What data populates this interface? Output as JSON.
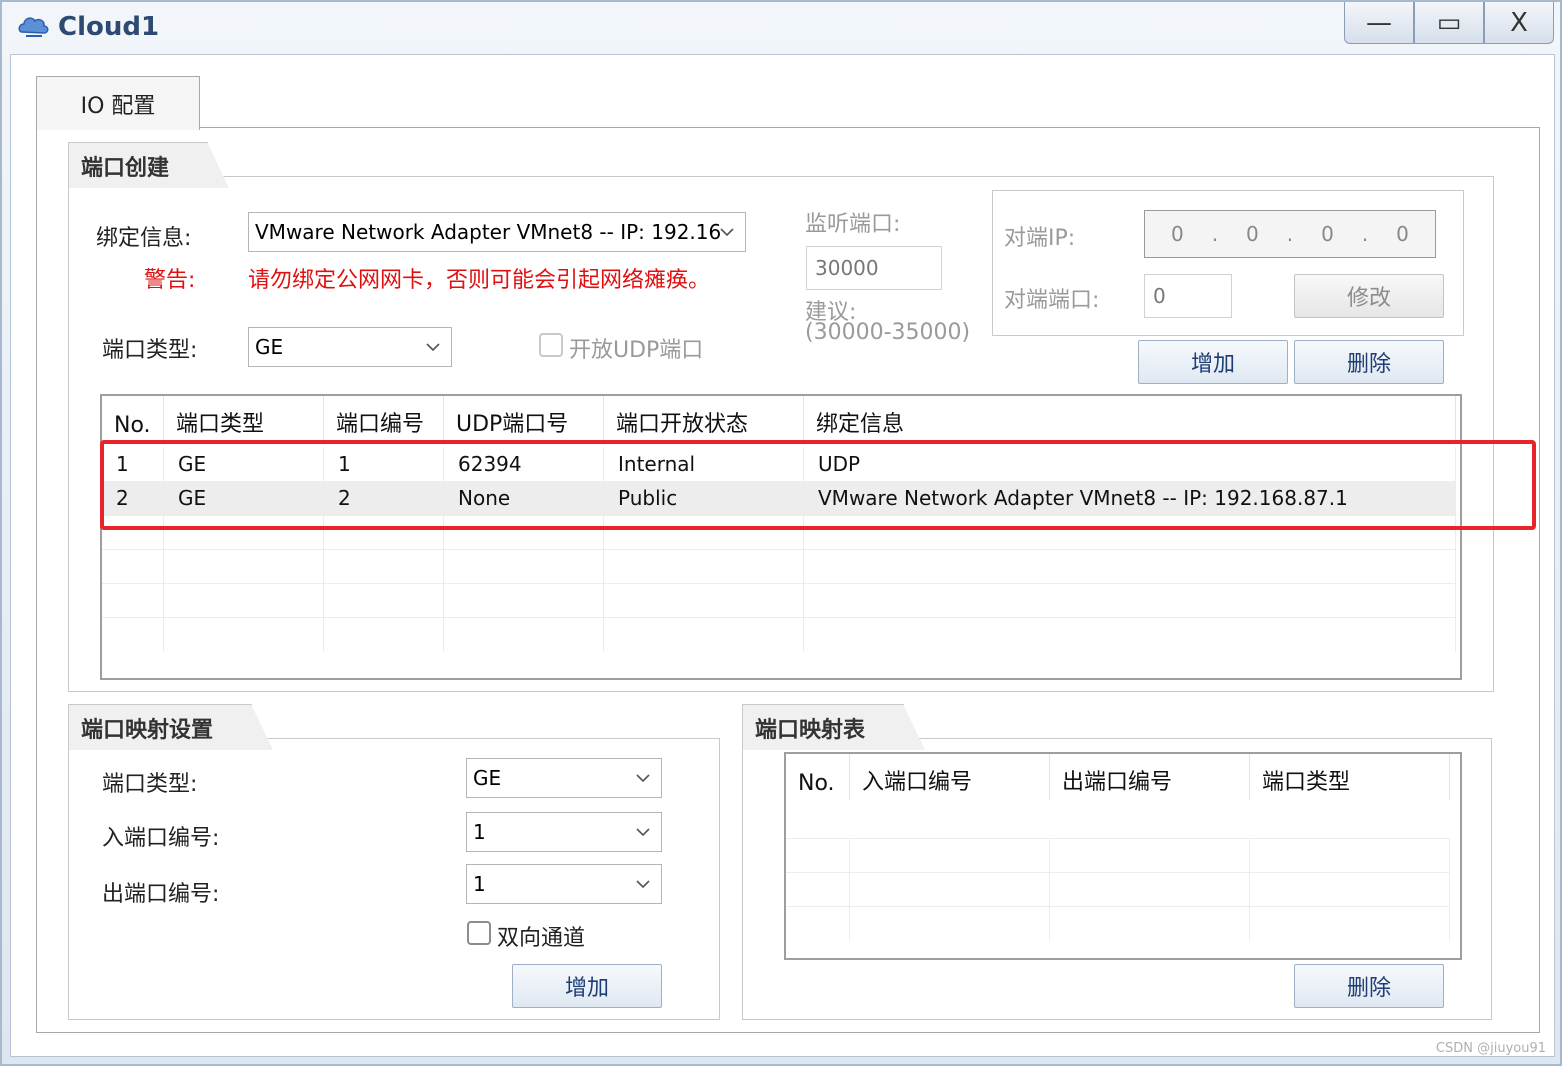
{
  "window": {
    "title": "Cloud1",
    "minimize_glyph": "—",
    "maximize_glyph": "▭",
    "close_glyph": "X"
  },
  "tab": {
    "label": "IO 配置"
  },
  "port_create": {
    "group_title": "端口创建",
    "bind_label": "绑定信息:",
    "bind_value": "VMware Network Adapter VMnet8 -- IP: 192.16",
    "warning_label": "警告:",
    "warning_text": "请勿绑定公网网卡，否则可能会引起网络瘫痪。",
    "port_type_label": "端口类型:",
    "port_type_value": "GE",
    "udp_checkbox_label": "开放UDP端口",
    "listen_port_label": "监听端口:",
    "listen_port_value": "30000",
    "suggest_label": "建议:",
    "suggest_range": "(30000-35000)",
    "peer_ip_label": "对端IP:",
    "peer_ip_octets": [
      "0",
      ".",
      "0",
      ".",
      "0",
      ".",
      "0"
    ],
    "peer_port_label": "对端端口:",
    "peer_port_value": "0",
    "modify_button": "修改",
    "add_button": "增加",
    "delete_button": "删除",
    "table": {
      "columns": [
        "No.",
        "端口类型",
        "端口编号",
        "UDP端口号",
        "端口开放状态",
        "绑定信息"
      ],
      "rows": [
        [
          "1",
          "GE",
          "1",
          "62394",
          "Internal",
          "UDP"
        ],
        [
          "2",
          "GE",
          "2",
          "None",
          "Public",
          "VMware Network Adapter VMnet8 -- IP: 192.168.87.1"
        ]
      ]
    }
  },
  "port_mapping": {
    "group_title": "端口映射设置",
    "port_type_label": "端口类型:",
    "port_type_value": "GE",
    "in_port_label": "入端口编号:",
    "in_port_value": "1",
    "out_port_label": "出端口编号:",
    "out_port_value": "1",
    "bidirectional_label": "双向通道",
    "add_button": "增加"
  },
  "mapping_table": {
    "group_title": "端口映射表",
    "columns": [
      "No.",
      "入端口编号",
      "出端口编号",
      "端口类型"
    ],
    "delete_button": "删除"
  },
  "watermark": "CSDN @jiuyou91",
  "colors": {
    "accent": "#1e3c74",
    "warning": "#e01010",
    "highlight_box": "#e8232a"
  }
}
